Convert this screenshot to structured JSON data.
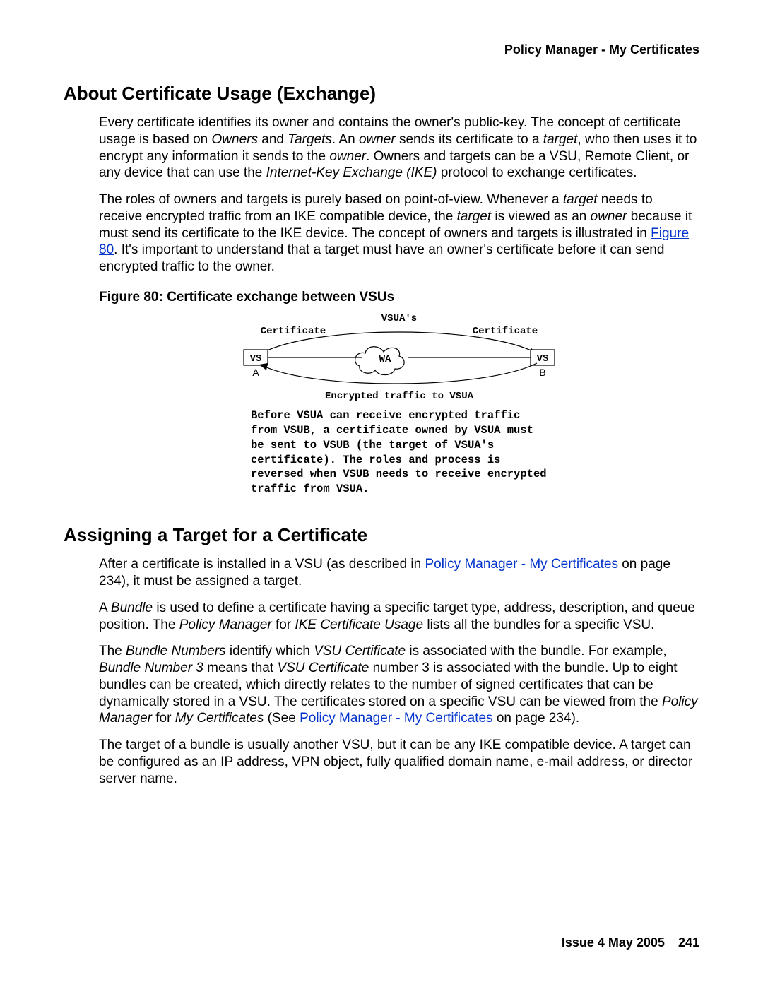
{
  "header": {
    "running": "Policy Manager - My Certificates"
  },
  "sections": {
    "s1": {
      "title": "About Certificate Usage (Exchange)",
      "p1_a": "Every certificate identifies its owner and contains the owner's public-key. The concept of certificate usage is based on ",
      "p1_b": "Owners",
      "p1_c": " and ",
      "p1_d": "Targets",
      "p1_e": ". An ",
      "p1_f": "owner",
      "p1_g": " sends its certificate to a ",
      "p1_h": "target",
      "p1_i": ", who then uses it to encrypt any information it sends to the ",
      "p1_j": "owner",
      "p1_k": ". Owners and targets can be a VSU, Remote Client, or any device that can use the ",
      "p1_l": "Internet-Key Exchange (IKE)",
      "p1_m": " protocol to exchange certificates.",
      "p2_a": "The roles of owners and targets is purely based on point-of-view. Whenever a ",
      "p2_b": "target",
      "p2_c": " needs to receive encrypted traffic from an IKE compatible device, the ",
      "p2_d": "target",
      "p2_e": " is viewed as an ",
      "p2_f": "owner",
      "p2_g": " because it must send its certificate to the IKE device. The concept of owners and targets is illustrated in ",
      "p2_link": "Figure 80",
      "p2_h": ". It's important to understand that a target must have an owner's certificate before it can send encrypted traffic to the owner."
    },
    "fig": {
      "title": "Figure 80: Certificate exchange between VSUs",
      "label_vsua": "VSUA's",
      "label_cert_l": "Certificate",
      "label_cert_r": "Certificate",
      "node_vsua": "VS",
      "node_vsua_sub": "A",
      "node_wa": "WA",
      "node_vsub": "VS",
      "node_vsub_sub": "B",
      "enc_line": "Encrypted traffic to VSUA",
      "caption": "Before VSUA can receive encrypted traffic from VSUB, a certificate owned by VSUA must be sent to VSUB (the target of VSUA's certificate). The roles and process is reversed when VSUB needs to receive encrypted traffic from VSUA."
    },
    "s2": {
      "title": "Assigning a Target for a Certificate",
      "p1_a": "After a certificate is installed in a VSU (as described in ",
      "p1_link": "Policy Manager - My Certificates",
      "p1_b": " on page 234), it must be assigned a target.",
      "p2_a": "A ",
      "p2_b": "Bundle",
      "p2_c": " is used to define a certificate having a specific target type, address, description, and queue position. The ",
      "p2_d": "Policy Manager",
      "p2_e": " for ",
      "p2_f": "IKE Certificate Usage",
      "p2_g": " lists all the bundles for a specific VSU.",
      "p3_a": "The ",
      "p3_b": "Bundle Numbers",
      "p3_c": " identify which ",
      "p3_d": "VSU Certificate",
      "p3_e": " is associated with the bundle. For example, ",
      "p3_f": "Bundle Number 3",
      "p3_g": " means that ",
      "p3_h": "VSU Certificate",
      "p3_i": " number 3 is associated with the bundle. Up to eight bundles can be created, which directly relates to the number of signed certificates that can be dynamically stored in a VSU. The certificates stored on a specific VSU can be viewed from the ",
      "p3_j": "Policy Manager",
      "p3_k": " for ",
      "p3_l": "My Certificates",
      "p3_m": " (See ",
      "p3_link": "Policy Manager - My Certificates",
      "p3_n": " on page 234).",
      "p4": "The target of a bundle is usually another VSU, but it can be any IKE compatible device. A target can be configured as an IP address, VPN object, fully qualified domain name, e-mail address, or director server name."
    }
  },
  "footer": {
    "issue": "Issue 4   May 2005",
    "page": "241"
  }
}
